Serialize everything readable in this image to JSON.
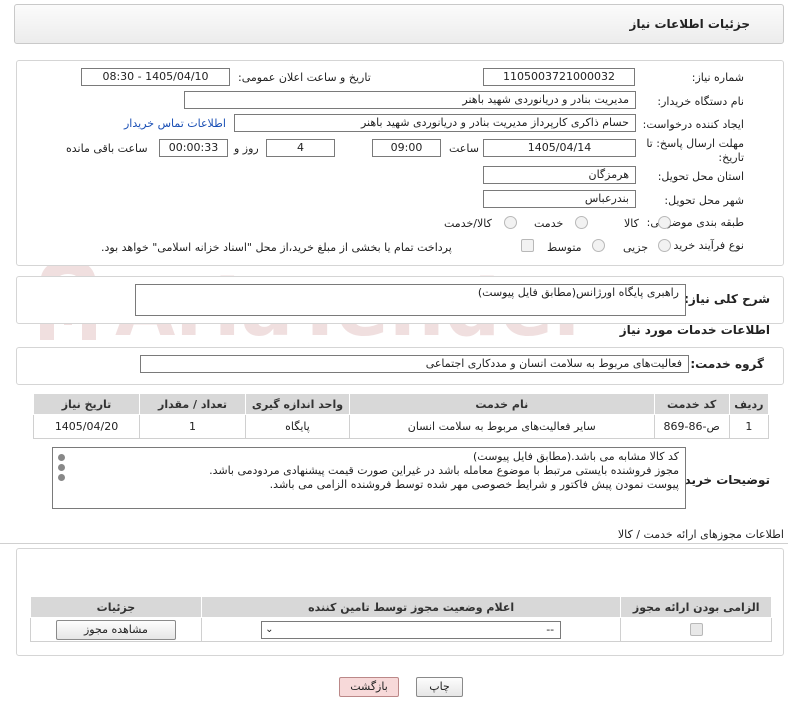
{
  "header": {
    "title": "جزئیات اطلاعات نیاز"
  },
  "form": {
    "need_number_label": "شماره نیاز:",
    "need_number": "1105003721000032",
    "announce_label": "تاریخ و ساعت اعلان عمومی:",
    "announce_value": "1405/04/10 - 08:30",
    "buyer_org_label": "نام دستگاه خریدار:",
    "buyer_org": "مدیریت بنادر و دریانوردی شهید باهنر",
    "creator_label": "ایجاد کننده درخواست:",
    "creator": "حسام  ذاکری کارپرداز مدیریت بنادر و دریانوردی شهید باهنر",
    "contact_link": "اطلاعات تماس خریدار",
    "deadline_label_1": "مهلت ارسال پاسخ: تا",
    "deadline_label_2": "تاریخ:",
    "deadline_date": "1405/04/14",
    "time_label": "ساعت",
    "deadline_time": "09:00",
    "days_value": "4",
    "days_label": "روز و",
    "remaining_time": "00:00:33",
    "remaining_label": "ساعت باقی مانده",
    "province_label": "استان محل تحویل:",
    "province": "هرمزگان",
    "city_label": "شهر محل تحویل:",
    "city": "بندرعباس",
    "category_label": "طبقه بندی موضوعی:",
    "category_options": [
      "کالا",
      "خدمت",
      "کالا/خدمت"
    ],
    "process_label": "نوع فرآیند خرید :",
    "process_options": [
      "جزیی",
      "متوسط"
    ],
    "payment_note": "پرداخت تمام یا بخشی از مبلغ خرید،از محل \"اسناد خزانه اسلامی\" خواهد بود."
  },
  "summary": {
    "label": "شرح کلی نیاز:",
    "value": "راهبری پایگاه اورژانس(مطابق فایل پیوست)"
  },
  "services": {
    "title": "اطلاعات خدمات مورد نیاز",
    "group_label": "گروه خدمت:",
    "group_value": "فعالیت‌های مربوط به سلامت انسان و مددکاری اجتماعی",
    "columns": [
      "ردیف",
      "کد خدمت",
      "نام خدمت",
      "واحد اندازه گیری",
      "تعداد / مقدار",
      "تاریخ نیاز"
    ],
    "rows": [
      [
        "1",
        "ص-86-869",
        "سایر فعالیت‌های مربوط به سلامت انسان",
        "پایگاه",
        "1",
        "1405/04/20"
      ]
    ]
  },
  "buyer_notes": {
    "label": "توضیحات خریدار:",
    "lines": [
      "کد کالا مشابه می باشد.(مطابق فایل پیوست)",
      "مجوز فروشنده بایستی مرتبط با موضوع معامله باشد در غیراین صورت قیمت پیشنهادی مردودمی باشد.",
      "پیوست نمودن پیش فاکتور و شرایط خصوصی مهر شده توسط فروشنده الزامی می باشد."
    ]
  },
  "permits": {
    "title": "اطلاعات مجوزهای ارائه خدمت / کالا",
    "columns": [
      "الزامی بودن ارائه مجوز",
      "اعلام وضعیت مجوز توسط تامین کننده",
      "جزئیات"
    ],
    "select_value": "--",
    "view_button": "مشاهده مجوز"
  },
  "footer": {
    "print_button": "چاپ",
    "back_button": "بازگشت"
  },
  "watermark": {
    "text": "AriaTender.neT"
  },
  "colors": {
    "link": "#1a4fb5",
    "back_button_bg": "#f7d9d9"
  }
}
